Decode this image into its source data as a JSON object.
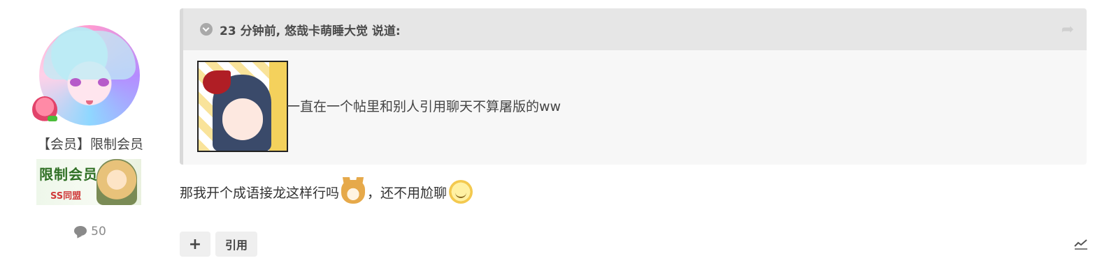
{
  "author": {
    "role": "【会员】限制会员",
    "banner_text": "限制会员",
    "banner_subtext": "SS同盟",
    "post_count": "50"
  },
  "quote": {
    "header": "23 分钟前, 悠哉卡萌睡大觉 说道:",
    "text": "一直在一个帖里和别人引用聊天不算屠版的ww"
  },
  "message": {
    "part1": "那我开个成语接龙这样行吗",
    "part2": "，还不用尬聊"
  },
  "actions": {
    "plus_label": "+",
    "quote_label": "引用"
  },
  "colors": {
    "quote_bg": "#f7f7f7",
    "quote_head_bg": "#e6e6e6",
    "quote_border": "#d9d9d9",
    "button_bg": "#efefef"
  },
  "icons": [
    "expand-icon",
    "jump-to-quote-icon",
    "comment-bubble-icon",
    "stats-chart-icon"
  ]
}
